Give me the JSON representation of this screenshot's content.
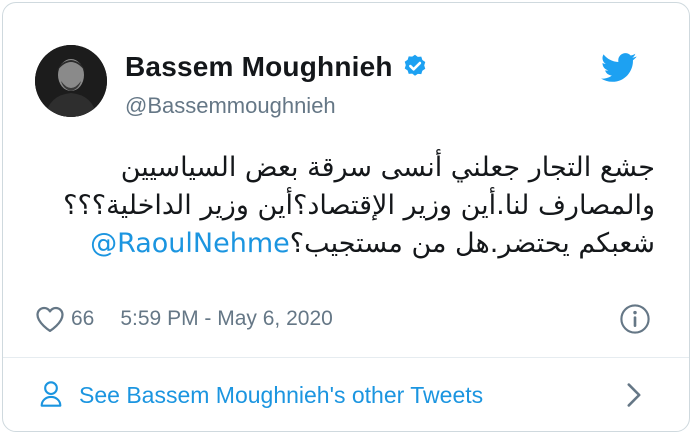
{
  "author": {
    "name": "Bassem Moughnieh",
    "handle": "@Bassemmoughnieh",
    "verified": true
  },
  "tweet": {
    "line1": "جشع التجار جعلني أنسى سرقة بعض السياسيين",
    "line2": "والمصارف لنا.أين وزير الإقتصاد؟أين وزير الداخلية؟؟؟",
    "line3_text": "شعبكم يحتضر.هل من مستجيب؟",
    "mention": "@RaoulNehme"
  },
  "meta": {
    "likes": "66",
    "timestamp": "5:59 PM - May 6, 2020"
  },
  "footer": {
    "label": "See Bassem Moughnieh's other Tweets"
  },
  "icons": {
    "brand": "twitter-bird-icon",
    "verified": "verified-badge-icon",
    "like": "heart-icon",
    "info": "info-icon",
    "profile": "person-icon",
    "next": "chevron-right-icon"
  },
  "colors": {
    "accent": "#1da1f2",
    "link": "#1b95e0",
    "muted": "#657786",
    "text": "#14171a",
    "border": "#cfd9de"
  }
}
